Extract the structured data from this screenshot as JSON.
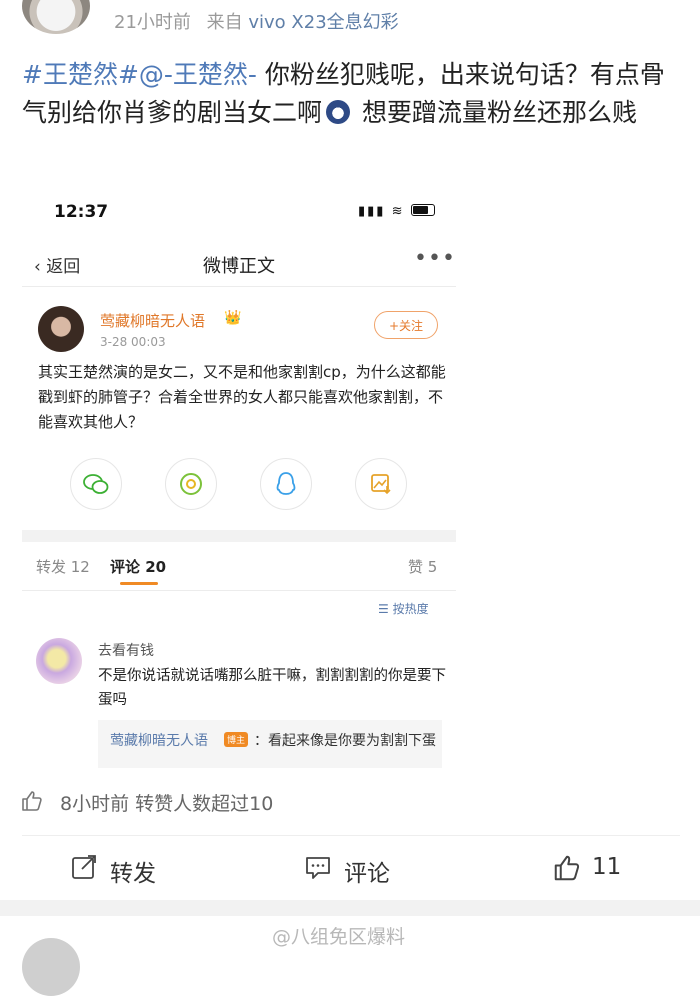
{
  "post": {
    "time": "21小时前",
    "from_prefix": "来自",
    "device": "vivo X23全息幻彩",
    "topic": "#王楚然#@-王楚然-",
    "text_part1": " 你粉丝犯贱呢，出来说句话？有点骨气别给你肖爹的剧当女二啊",
    "text_part2": " 想要蹭流量粉丝还那么贱"
  },
  "embed": {
    "status_time": "12:37",
    "status_icons": "▮▮▮ ≋",
    "nav": {
      "back": "返回",
      "title": "微博正文",
      "more": "•••"
    },
    "author": {
      "name": "莺藏柳暗无人语",
      "crown": "👑",
      "time": "3-28 00:03",
      "follow": "+关注"
    },
    "text": "其实王楚然演的是女二，又不是和他家割割cp，为什么这都能戳到虾的肺管子？合着全世界的女人都只能喜欢他家割割，不能喜欢其他人？",
    "share": [
      "wechat-icon",
      "moments-icon",
      "qq-icon",
      "save-image-icon"
    ],
    "tabs": {
      "repost": "转发 12",
      "comment": "评论 20",
      "like": "赞 5"
    },
    "sort": "按热度",
    "comment": {
      "name": "去看有钱",
      "text": "不是你说话就说话嘴那么脏干嘛，割割割割的你是要下蛋吗",
      "reply_name": "莺藏柳暗无人语",
      "reply_badge": "博主",
      "reply_text": "：看起来像是你要为割割下蛋"
    }
  },
  "footer": {
    "like_info": "8小时前 转赞人数超过10",
    "repost": "转发",
    "comment": "评论",
    "like_count": "11",
    "watermark": "@八组免区爆料"
  },
  "colors": {
    "topic": "#4f7ab8",
    "accent_orange": "#f08a24",
    "link_blue": "#5b7bab"
  }
}
